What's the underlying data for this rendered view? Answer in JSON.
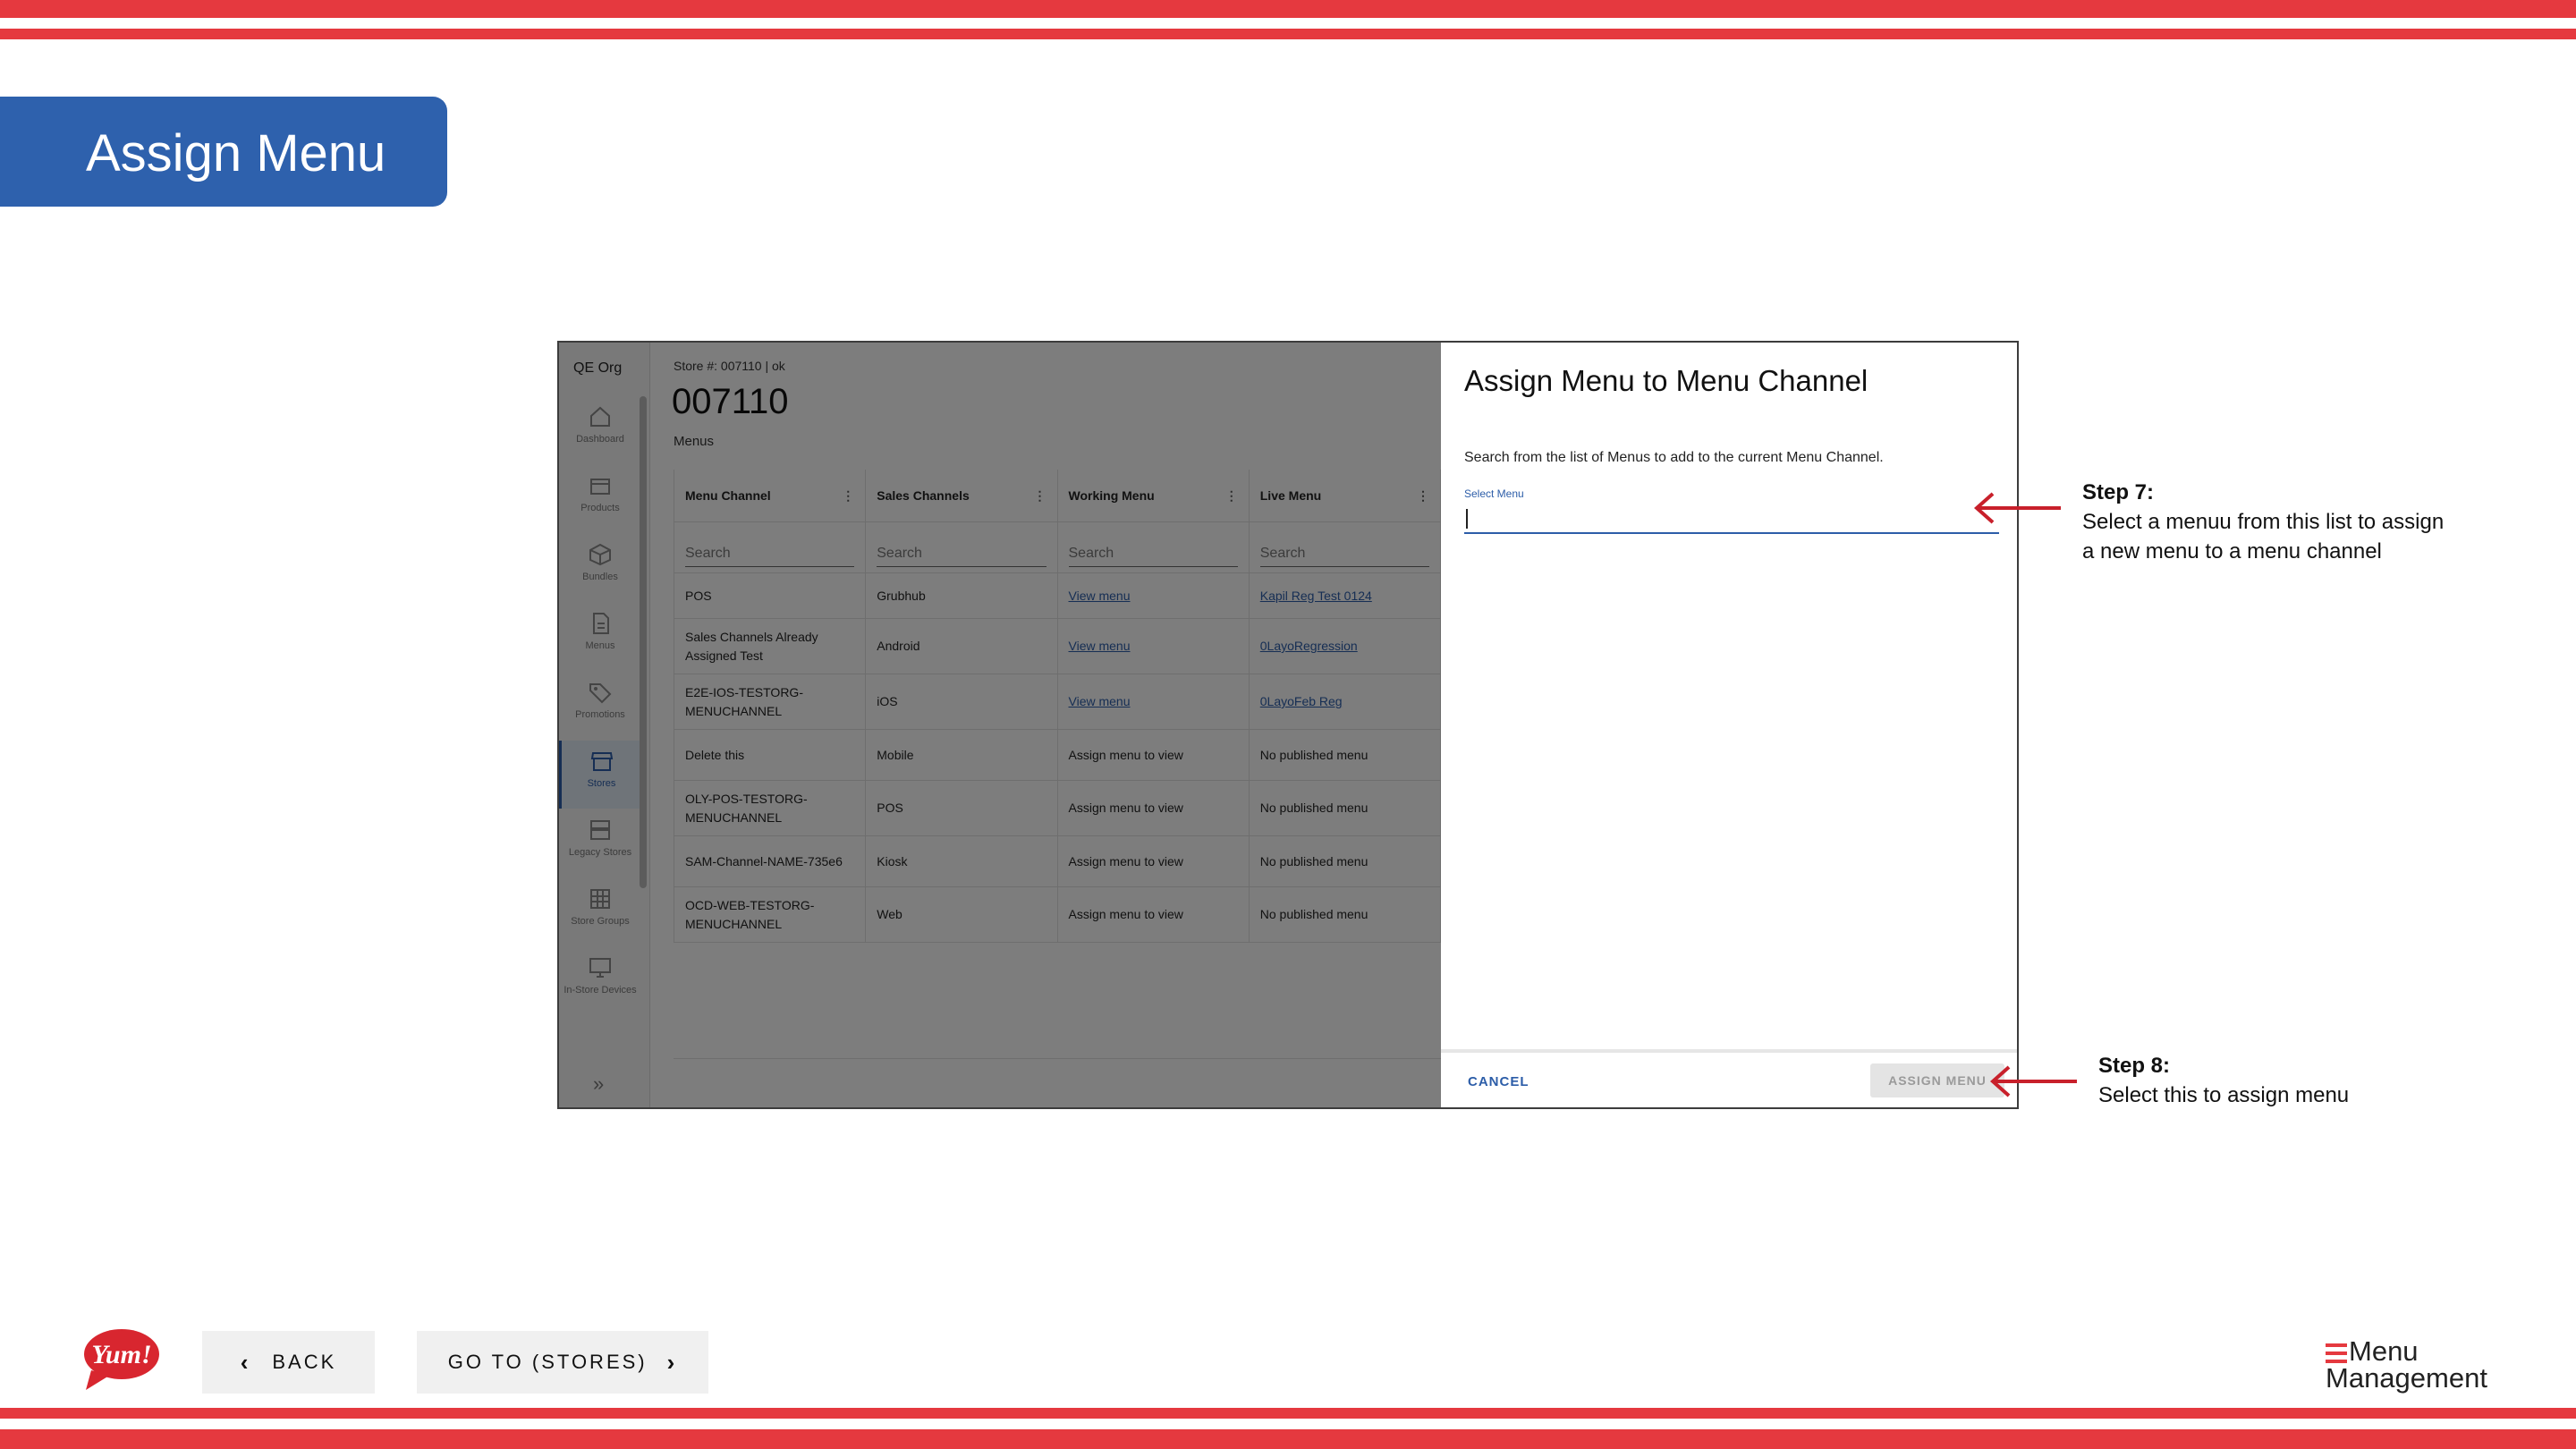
{
  "page": {
    "title": "Assign Menu"
  },
  "app": {
    "org": "QE Org",
    "nav": [
      {
        "label": "Dashboard",
        "icon": "home-icon"
      },
      {
        "label": "Products",
        "icon": "box-icon"
      },
      {
        "label": "Bundles",
        "icon": "cube-icon"
      },
      {
        "label": "Menus",
        "icon": "document-icon"
      },
      {
        "label": "Promotions",
        "icon": "tag-icon"
      },
      {
        "label": "Stores",
        "icon": "store-icon",
        "active": true
      },
      {
        "label": "Legacy Stores",
        "icon": "archive-icon"
      },
      {
        "label": "Store Groups",
        "icon": "grid-icon"
      },
      {
        "label": "In-Store Devices",
        "icon": "monitor-icon"
      }
    ],
    "crumb": "Store #: 007110 | ok",
    "store_number": "007110",
    "section": "Menus",
    "table": {
      "headers": [
        "Menu Channel",
        "Sales Channels",
        "Working Menu",
        "Live Menu"
      ],
      "search_placeholder": "Search",
      "rows": [
        {
          "channel": "POS",
          "sales": "Grubhub",
          "working": "View menu",
          "working_link": true,
          "live": "Kapil Reg Test 0124",
          "live_link": true
        },
        {
          "channel": "Sales Channels Already Assigned Test",
          "sales": "Android",
          "working": "View menu",
          "working_link": true,
          "live": "0LayoRegression",
          "live_link": true
        },
        {
          "channel": "E2E-IOS-TESTORG-MENUCHANNEL",
          "sales": "iOS",
          "working": "View menu",
          "working_link": true,
          "live": "0LayoFeb Reg",
          "live_link": true
        },
        {
          "channel": "Delete this",
          "sales": "Mobile",
          "working": "Assign menu to view",
          "working_link": false,
          "live": "No published menu",
          "live_link": false
        },
        {
          "channel": "OLY-POS-TESTORG-MENUCHANNEL",
          "sales": "POS",
          "working": "Assign menu to view",
          "working_link": false,
          "live": "No published menu",
          "live_link": false
        },
        {
          "channel": "SAM-Channel-NAME-735e6",
          "sales": "Kiosk",
          "working": "Assign menu to view",
          "working_link": false,
          "live": "No published menu",
          "live_link": false
        },
        {
          "channel": "OCD-WEB-TESTORG-MENUCHANNEL",
          "sales": "Web",
          "working": "Assign menu to view",
          "working_link": false,
          "live": "No published menu",
          "live_link": false
        }
      ]
    }
  },
  "dialog": {
    "title": "Assign Menu to Menu Channel",
    "description": "Search from the list of Menus to add to the current Menu Channel.",
    "select_label": "Select Menu",
    "select_value": "",
    "cancel_label": "CANCEL",
    "assign_label": "ASSIGN MENU"
  },
  "annotations": {
    "step7_title": "Step 7:",
    "step7_line1": "Select a menuu from this list to assign",
    "step7_line2": "a new menu to a menu channel",
    "step8_title": "Step 8:",
    "step8_text": "Select this to assign menu"
  },
  "footer": {
    "brand": "Yum!",
    "back_label": "BACK",
    "goto_label": "GO TO (STORES)",
    "logo_line1": "Menu",
    "logo_line2": "Management"
  },
  "colors": {
    "accent_red": "#e5393f",
    "banner_blue": "#2e61ad",
    "link_blue": "#2c5da8"
  }
}
